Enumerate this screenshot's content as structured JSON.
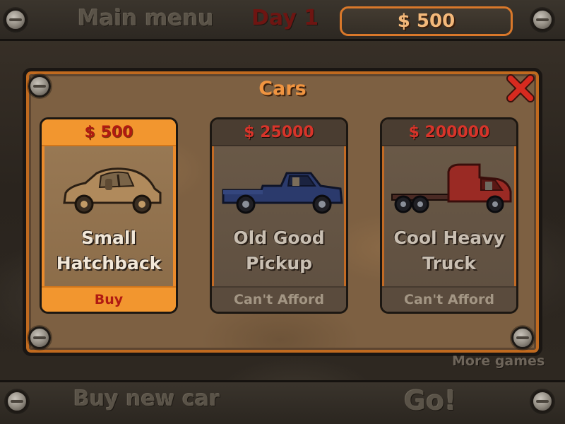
{
  "top_bar": {
    "main_menu_label": "Main menu",
    "day_label": "Day 1",
    "money_display": "$ 500"
  },
  "dialog": {
    "title": "Cars",
    "close_icon": "close-x-icon",
    "cars": [
      {
        "price": "$ 500",
        "name_line1": "Small",
        "name_line2": "Hatchback",
        "action": "Buy",
        "icon": "hatchback-car-icon",
        "affordable": true
      },
      {
        "price": "$ 25000",
        "name_line1": "Old Good",
        "name_line2": "Pickup",
        "action": "Can't Afford",
        "icon": "pickup-truck-icon",
        "affordable": false
      },
      {
        "price": "$ 200000",
        "name_line1": "Cool Heavy",
        "name_line2": "Truck",
        "action": "Can't Afford",
        "icon": "semi-truck-icon",
        "affordable": false
      }
    ]
  },
  "more_games_label": "More games",
  "bottom_bar": {
    "buy_new_car_label": "Buy new car",
    "go_label": "Go!"
  },
  "colors": {
    "accent_orange": "#f2962f",
    "price_red": "#d8342a",
    "close_red": "#d72a1f"
  }
}
